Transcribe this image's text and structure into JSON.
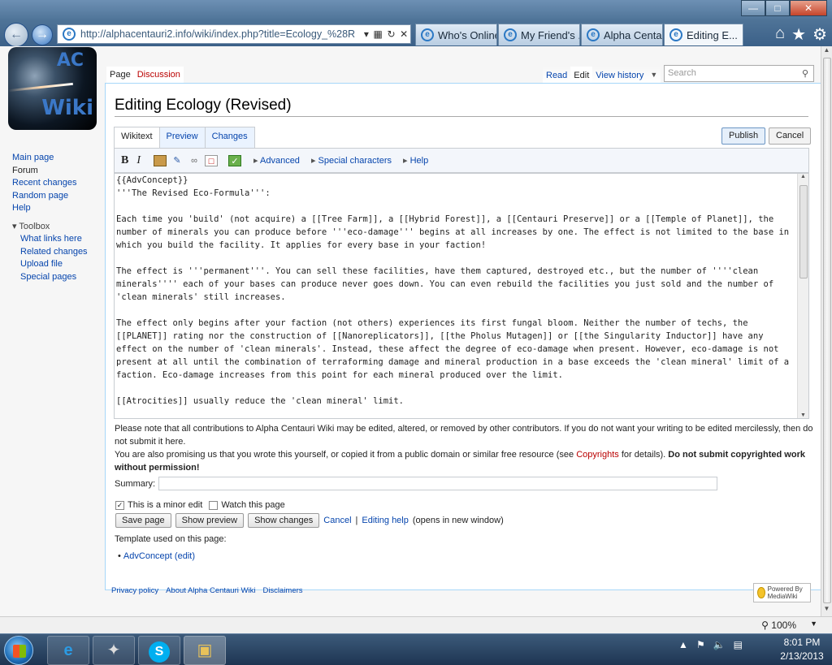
{
  "browser": {
    "url": "http://alphacentauri2.info/wiki/index.php?title=Ecology_%28R",
    "tabs": [
      {
        "label": "Who's Online"
      },
      {
        "label": "My Friend's ..."
      },
      {
        "label": "Alpha Centa..."
      },
      {
        "label": "Editing E..."
      }
    ],
    "zoom": "100%"
  },
  "logo": {
    "line1": "AC",
    "line2": "Wiki"
  },
  "sidebar": {
    "nav": [
      "Main page",
      "Forum",
      "Recent changes",
      "Random page",
      "Help"
    ],
    "toolbox_heading": "Toolbox",
    "toolbox": [
      "What links here",
      "Related changes",
      "Upload file",
      "Special pages"
    ]
  },
  "page_tabs": {
    "page": "Page",
    "discussion": "Discussion",
    "read": "Read",
    "edit": "Edit",
    "history": "View history"
  },
  "search": {
    "placeholder": "Search"
  },
  "title": "Editing Ecology (Revised)",
  "edit_tabs": {
    "wikitext": "Wikitext",
    "preview": "Preview",
    "changes": "Changes"
  },
  "buttons": {
    "publish": "Publish",
    "cancel": "Cancel"
  },
  "toolbar": {
    "bold": "B",
    "italic": "I",
    "advanced": "Advanced",
    "special": "Special characters",
    "help": "Help"
  },
  "editor_text": "{{AdvConcept}}\n'''The Revised Eco-Formula''':\n\nEach time you 'build' (not acquire) a [[Tree Farm]], a [[Hybrid Forest]], a [[Centauri Preserve]] or a [[Temple of Planet]], the number of minerals you can produce before '''eco-damage''' begins at all increases by one. The effect is not limited to the base in which you build the facility. It applies for every base in your faction!\n\nThe effect is '''permanent'''. You can sell these facilities, have them captured, destroyed etc., but the number of ''''clean minerals'''' each of your bases can produce never goes down. You can even rebuild the facilities you just sold and the number of 'clean minerals' still increases.\n\nThe effect only begins after your faction (not others) experiences its first fungal bloom. Neither the number of techs, the [[PLANET]] rating nor the construction of [[Nanoreplicators]], [[the Pholus Mutagen]] or [[the Singularity Inductor]] have any effect on the number of 'clean minerals'. Instead, these affect the degree of eco-damage when present. However, eco-damage is not present at all until the combination of terraforming damage and mineral production in a base exceeds the 'clean mineral' limit of a faction. Eco-damage increases from this point for each mineral produced over the limit.\n\n[[Atrocities]] usually reduce the 'clean mineral' limit.",
  "notice": {
    "line1": "Please note that all contributions to Alpha Centauri Wiki may be edited, altered, or removed by other contributors. If you do not want your writing to be edited mercilessly, then do not submit it here.",
    "line2a": "You are also promising us that you wrote this yourself, or copied it from a public domain or similar free resource (see ",
    "copyrights": "Copyrights",
    "line2b": " for details). ",
    "bold": "Do not submit copyrighted work without permission!"
  },
  "summary_label": "Summary:",
  "checks": {
    "minor": "This is a minor edit",
    "watch": "Watch this page"
  },
  "actions": {
    "save": "Save page",
    "preview": "Show preview",
    "changes": "Show changes",
    "cancel": "Cancel",
    "sep": "|",
    "help": "Editing help",
    "help_note": "(opens in new window)"
  },
  "templates": {
    "heading": "Template used on this page:",
    "item": "AdvConcept",
    "edit": "(edit)"
  },
  "footer": {
    "privacy": "Privacy policy",
    "about": "About Alpha Centauri Wiki",
    "disclaimers": "Disclaimers",
    "mediawiki": "Powered By MediaWiki"
  },
  "clock": {
    "time": "8:01 PM",
    "date": "2/13/2013"
  }
}
